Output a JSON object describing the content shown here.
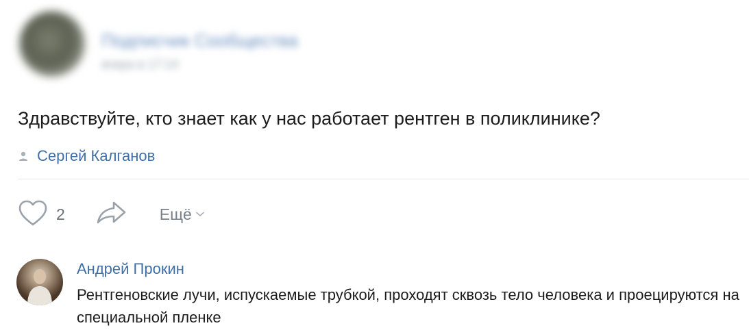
{
  "post": {
    "author_name": "Подписчик Сообщества",
    "date": "вчера в 17:14",
    "text": "Здравствуйте, кто знает как у нас работает рентген в поликлинике?",
    "signer_name": "Сергей Калганов"
  },
  "actions": {
    "like_count": "2",
    "more_label": "Ещё"
  },
  "comment": {
    "author_name": "Андрей Прокин",
    "text": "Рентгеновские лучи, испускаемые трубкой, проходят сквозь тело человека и проецируются на специальной пленке"
  },
  "colors": {
    "link": "#3f6fa6",
    "text": "#1c1c1c",
    "muted": "#7a8088"
  }
}
